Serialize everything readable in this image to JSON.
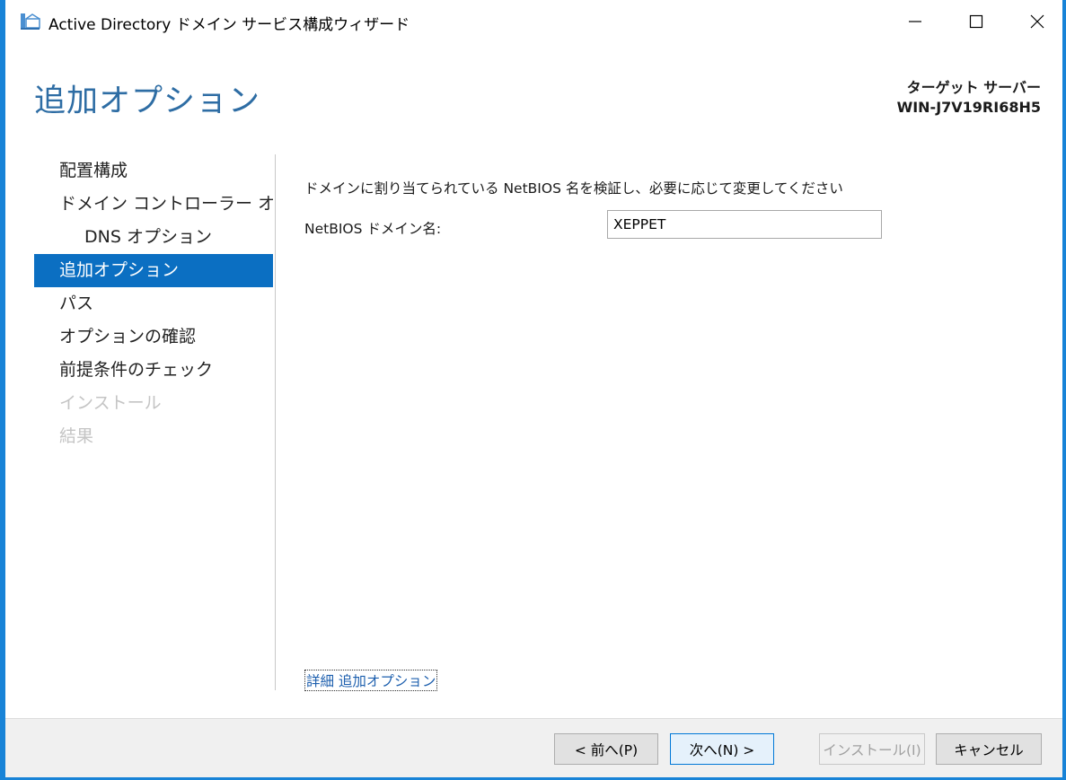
{
  "window": {
    "title": "Active Directory ドメイン サービス構成ウィザード",
    "accent_color": "#1883d7"
  },
  "header": {
    "page_title": "追加オプション",
    "target_label": "ターゲット サーバー",
    "target_server": "WIN-J7V19RI68H5"
  },
  "nav": {
    "items": [
      {
        "label": "配置構成",
        "state": "normal"
      },
      {
        "label": "ドメイン コントローラー オプシ...",
        "state": "normal"
      },
      {
        "label": "DNS オプション",
        "state": "normal"
      },
      {
        "label": "追加オプション",
        "state": "active"
      },
      {
        "label": "パス",
        "state": "normal"
      },
      {
        "label": "オプションの確認",
        "state": "normal"
      },
      {
        "label": "前提条件のチェック",
        "state": "normal"
      },
      {
        "label": "インストール",
        "state": "disabled"
      },
      {
        "label": "結果",
        "state": "disabled"
      }
    ]
  },
  "content": {
    "description": "ドメインに割り当てられている NetBIOS 名を検証し、必要に応じて変更してください",
    "netbios_label": "NetBIOS ドメイン名:",
    "netbios_value": "XEPPET",
    "more_link": "詳細 追加オプション"
  },
  "footer": {
    "back_label": "< 前へ(P)",
    "next_label": "次へ(N) >",
    "install_label": "インストール(I)",
    "cancel_label": "キャンセル"
  }
}
